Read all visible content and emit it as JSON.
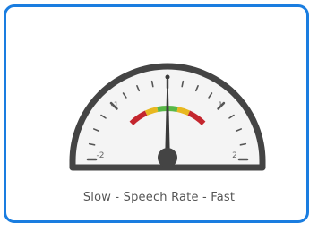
{
  "widget": {
    "caption": "Slow - Speech Rate - Fast",
    "accent_color": "#1a7de0"
  },
  "gauge": {
    "min": -2,
    "max": 2,
    "value": 0,
    "labels": [
      "-2",
      "-1",
      "1",
      "2"
    ],
    "zones": [
      {
        "from": -1,
        "to": -0.55,
        "color": "#c4262e"
      },
      {
        "from": -0.55,
        "to": -0.25,
        "color": "#e8b820"
      },
      {
        "from": -0.25,
        "to": 0.25,
        "color": "#58b847"
      },
      {
        "from": 0.25,
        "to": 0.55,
        "color": "#e8b820"
      },
      {
        "from": 0.55,
        "to": 1,
        "color": "#c4262e"
      }
    ]
  }
}
